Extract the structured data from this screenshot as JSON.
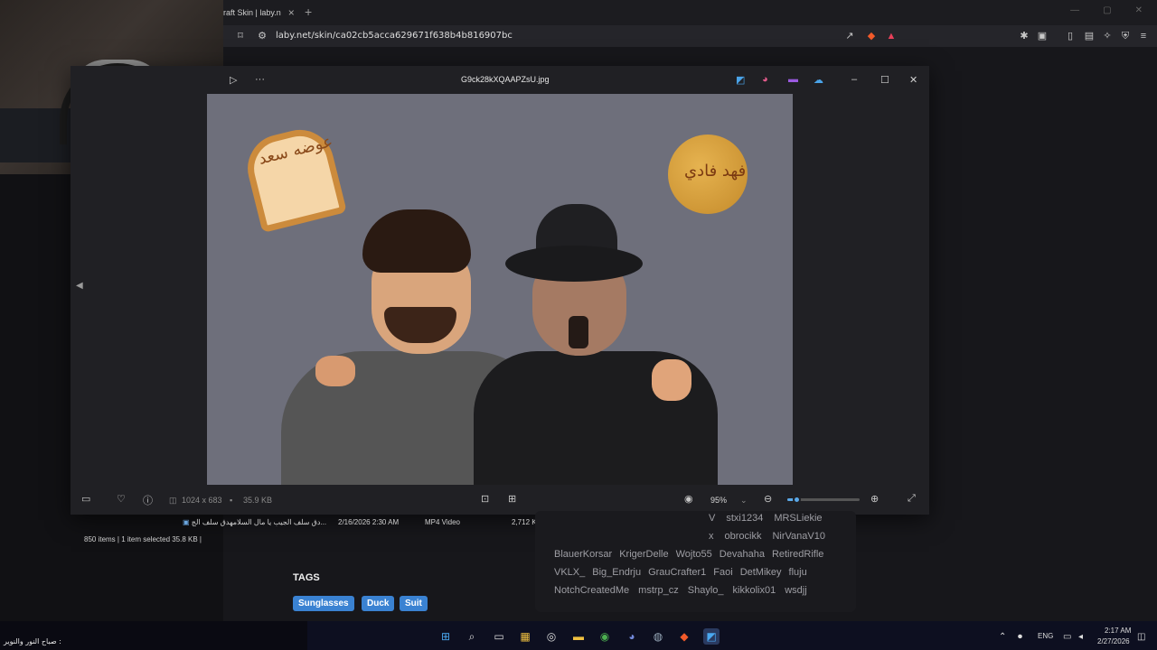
{
  "browser": {
    "tab_title": "raft Skin | laby.n",
    "tab_close": "×",
    "new_tab": "+",
    "url": "laby.net/skin/ca02cb5acca629671f638b4b816907bc"
  },
  "viewer": {
    "filename": "G9ck28kXQAAPZsU.jpg",
    "more_label": "···",
    "dimensions": "1024 x 683",
    "file_size": "35.9 KB",
    "zoom": "95%",
    "zoom_fraction": 0.12
  },
  "artwork": {
    "toast_text": "عوضه سعد",
    "cookie_text": "فهد فادي"
  },
  "explorer": {
    "file_name": "دق سلف الجيب يا مال السلامهدق سلف الج...",
    "file_date": "2/16/2026 2:30 AM",
    "file_type": "MP4 Video",
    "file_size": "2,712 KB",
    "status": "850 items  |  1 item selected  35.8 KB  |"
  },
  "skin_page": {
    "tags_heading": "TAGS",
    "tags": [
      "Sunglasses",
      "Duck",
      "Suit"
    ],
    "name_rows": [
      [
        "V",
        "stxi1234",
        "MRSLiekie"
      ],
      [
        "x",
        "obrocikk",
        "NirVanaV10"
      ],
      [
        "BlauerKorsar",
        "KrigerDelle",
        "Wojto55",
        "Devahaha",
        "RetiredRifle"
      ],
      [
        "VKLX_",
        "Big_Endrju",
        "GrauCrafter1",
        "Faoi",
        "DetMikey",
        "fluju"
      ],
      [
        "NotchCreatedMe",
        "mstrp_cz",
        "Shaylo_",
        "kikkolix01",
        "wsdjj"
      ]
    ]
  },
  "taskbar": {
    "ticker": "صباح النور والنوير : ",
    "language": "ENG",
    "time": "2:17 AM",
    "date": "2/27/2026"
  }
}
